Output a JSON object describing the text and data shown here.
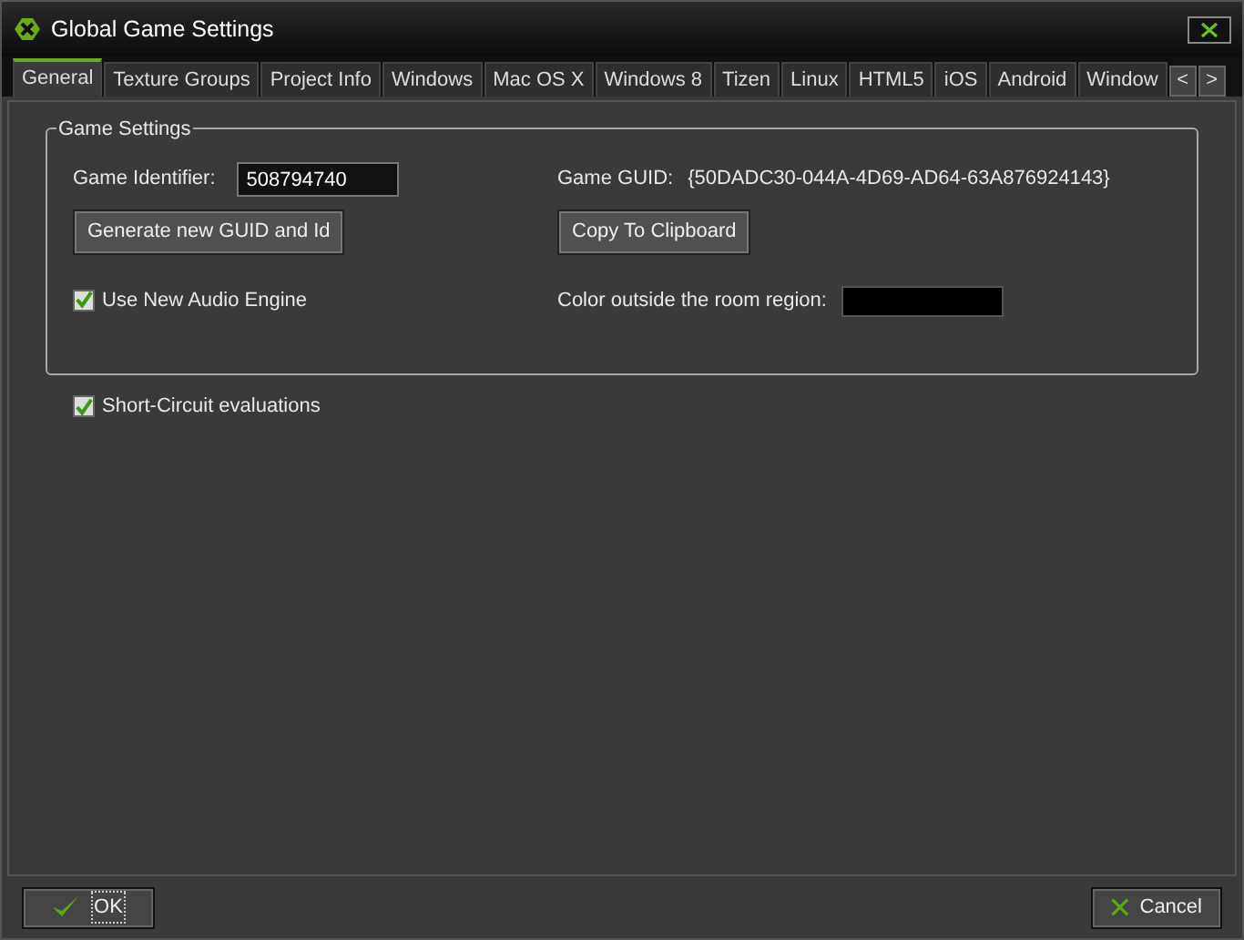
{
  "window": {
    "title": "Global Game Settings"
  },
  "tabs": [
    {
      "label": "General",
      "selected": true
    },
    {
      "label": "Texture Groups",
      "selected": false
    },
    {
      "label": "Project Info",
      "selected": false
    },
    {
      "label": "Windows",
      "selected": false
    },
    {
      "label": "Mac OS X",
      "selected": false
    },
    {
      "label": "Windows 8",
      "selected": false
    },
    {
      "label": "Tizen",
      "selected": false
    },
    {
      "label": "Linux",
      "selected": false
    },
    {
      "label": "HTML5",
      "selected": false
    },
    {
      "label": "iOS",
      "selected": false
    },
    {
      "label": "Android",
      "selected": false
    },
    {
      "label": "Window",
      "selected": false
    }
  ],
  "tab_scroll": [
    "<",
    ">"
  ],
  "group": {
    "title": "Game Settings",
    "game_identifier": {
      "label": "Game Identifier:",
      "value": "508794740"
    },
    "generate_button": "Generate new GUID and Id",
    "use_new_audio_engine": {
      "label": "Use New Audio Engine",
      "checked": true
    },
    "game_guid": {
      "label": "Game GUID:",
      "value": "{50DADC30-044A-4D69-AD64-63A876924143}"
    },
    "copy_button": "Copy To Clipboard",
    "outside_color": {
      "label": "Color outside the room region:",
      "color": "#000000"
    }
  },
  "short_circuit": {
    "label": "Short-Circuit evaluations",
    "checked": true
  },
  "buttons": [
    {
      "kind": "ok",
      "label": "OK"
    },
    {
      "kind": "cancel",
      "label": "Cancel"
    }
  ]
}
